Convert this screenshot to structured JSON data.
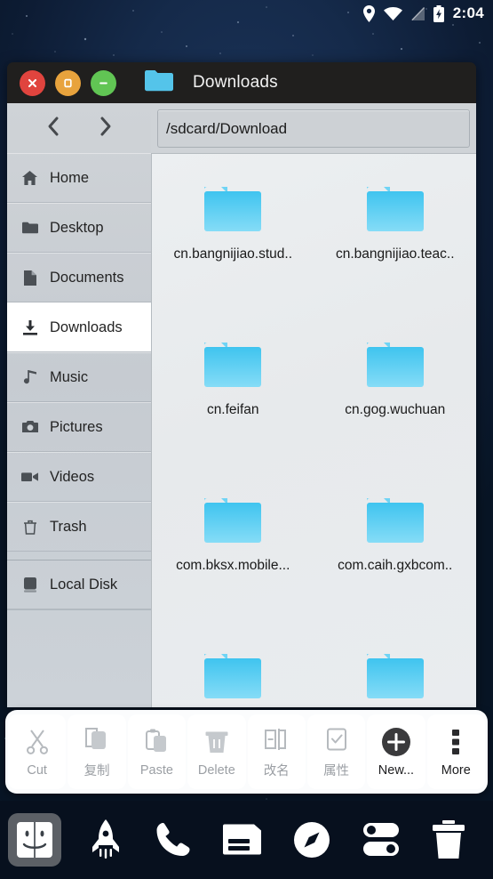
{
  "statusbar": {
    "icons": [
      "location-pin-icon",
      "wifi-icon",
      "signal-off-icon",
      "battery-charging-icon"
    ],
    "time": "2:04"
  },
  "window": {
    "controls": [
      {
        "name": "close-button",
        "color": "#e0443e",
        "glyph": "x"
      },
      {
        "name": "maximize-button",
        "color": "#e8a33d",
        "glyph": "square"
      },
      {
        "name": "minimize-button",
        "color": "#61c554",
        "glyph": "minus"
      }
    ],
    "title_icon": "folder-icon",
    "title": "Downloads"
  },
  "nav": {
    "back_icon": "chevron-left-icon",
    "forward_icon": "chevron-right-icon"
  },
  "sidebar": {
    "items": [
      {
        "label": "Home",
        "icon": "home-icon",
        "selected": false,
        "group_start": false
      },
      {
        "label": "Desktop",
        "icon": "folder-icon",
        "selected": false,
        "group_start": false
      },
      {
        "label": "Documents",
        "icon": "document-icon",
        "selected": false,
        "group_start": false
      },
      {
        "label": "Downloads",
        "icon": "download-icon",
        "selected": true,
        "group_start": false
      },
      {
        "label": "Music",
        "icon": "music-note-icon",
        "selected": false,
        "group_start": false
      },
      {
        "label": "Pictures",
        "icon": "camera-icon",
        "selected": false,
        "group_start": false
      },
      {
        "label": "Videos",
        "icon": "video-icon",
        "selected": false,
        "group_start": false
      },
      {
        "label": "Trash",
        "icon": "trash-icon",
        "selected": false,
        "group_start": false
      },
      {
        "label": "Local Disk",
        "icon": "hard-disk-icon",
        "selected": false,
        "group_start": true
      }
    ]
  },
  "pathbar": {
    "value": "/sdcard/Download",
    "placeholder": "/sdcard/Download"
  },
  "files": {
    "items": [
      {
        "name": "cn.bangnijiao.stud..",
        "type": "folder"
      },
      {
        "name": "cn.bangnijiao.teac..",
        "type": "folder"
      },
      {
        "name": "cn.feifan",
        "type": "folder"
      },
      {
        "name": "cn.gog.wuchuan",
        "type": "folder"
      },
      {
        "name": "com.bksx.mobile...",
        "type": "folder"
      },
      {
        "name": "com.caih.gxbcom..",
        "type": "folder"
      },
      {
        "name": "",
        "type": "folder"
      },
      {
        "name": "",
        "type": "folder"
      }
    ]
  },
  "toolbar": {
    "buttons": [
      {
        "label": "Cut",
        "icon": "scissors-icon",
        "enabled": false
      },
      {
        "label": "复制",
        "icon": "copy-icon",
        "enabled": false
      },
      {
        "label": "Paste",
        "icon": "clipboard-icon",
        "enabled": false
      },
      {
        "label": "Delete",
        "icon": "trash-icon",
        "enabled": false
      },
      {
        "label": "改名",
        "icon": "rename-icon",
        "enabled": false
      },
      {
        "label": "属性",
        "icon": "properties-icon",
        "enabled": false
      },
      {
        "label": "New...",
        "icon": "plus-circle-icon",
        "enabled": true
      },
      {
        "label": "More",
        "icon": "more-vertical-icon",
        "enabled": true
      }
    ]
  },
  "dock": {
    "items": [
      {
        "name": "finder-icon",
        "active": true
      },
      {
        "name": "rocket-icon",
        "active": false
      },
      {
        "name": "phone-icon",
        "active": false
      },
      {
        "name": "messages-icon",
        "active": false
      },
      {
        "name": "compass-icon",
        "active": false
      },
      {
        "name": "settings-icon",
        "active": false
      },
      {
        "name": "trash-icon",
        "active": false
      }
    ]
  },
  "colors": {
    "accent_folder": "#54ccf2",
    "window_titlebar": "#201f1e",
    "sidebar": "#cbd0d5",
    "desktop": "#0d1c34"
  }
}
